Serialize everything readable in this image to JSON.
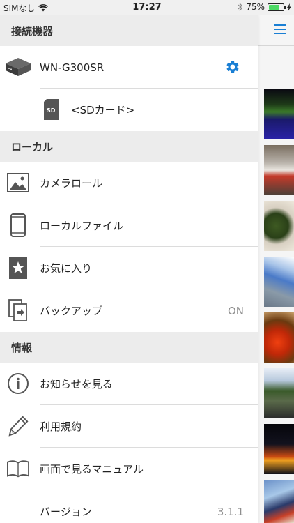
{
  "status_bar": {
    "carrier": "SIMなし",
    "time": "17:27",
    "battery": "75%",
    "battery_level": 0.75
  },
  "sections": {
    "devices": "接続機器",
    "local": "ローカル",
    "info": "情報"
  },
  "devices": {
    "router": "WN-G300SR",
    "sd_card": "<SDカード>"
  },
  "local_items": {
    "camera_roll": "カメラロール",
    "local_files": "ローカルファイル",
    "favorites": "お気に入り",
    "backup": "バックアップ",
    "backup_status": "ON"
  },
  "info_items": {
    "notices": "お知らせを見る",
    "terms": "利用規約",
    "manual": "画面で見るマニュアル",
    "version_label": "バージョン",
    "version_value": "3.1.1"
  },
  "colors": {
    "accent": "#1a7fd4",
    "section_bg": "#ececec"
  }
}
